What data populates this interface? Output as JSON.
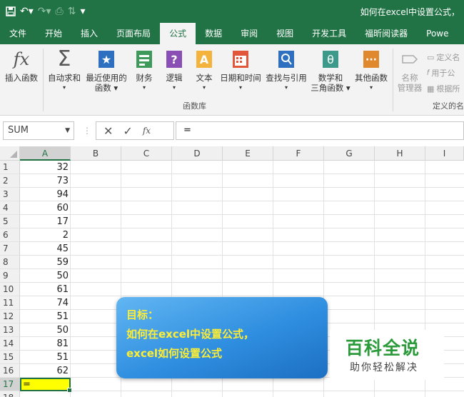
{
  "window": {
    "title": "如何在excel中设置公式，"
  },
  "tabs": [
    "文件",
    "开始",
    "插入",
    "页面布局",
    "公式",
    "数据",
    "审阅",
    "视图",
    "开发工具",
    "福昕阅读器",
    "Powe"
  ],
  "active_tab": "公式",
  "ribbon": {
    "insert_function": "插入函数",
    "autosum": "自动求和",
    "recent_line1": "最近使用的",
    "recent_line2": "函数",
    "financial": "财务",
    "logical": "逻辑",
    "text": "文本",
    "datetime": "日期和时间",
    "lookup": "查找与引用",
    "math_line1": "数学和",
    "math_line2": "三角函数",
    "other": "其他函数",
    "name_manager_line1": "名称",
    "name_manager_line2": "管理器",
    "define_name": "定义名",
    "use_in_formula": "用于公",
    "create_from_selection": "根据所",
    "library_group_label": "函数库",
    "names_group_label": "定义的名"
  },
  "formula_bar": {
    "name_box": "SUM",
    "formula": "="
  },
  "columns": [
    "A",
    "B",
    "C",
    "D",
    "E",
    "F",
    "G",
    "H",
    "I"
  ],
  "rows": [
    "1",
    "2",
    "3",
    "4",
    "5",
    "6",
    "7",
    "8",
    "9",
    "10",
    "11",
    "12",
    "13",
    "14",
    "15",
    "16",
    "17",
    "18"
  ],
  "column_a_values": [
    "32",
    "73",
    "94",
    "60",
    "17",
    "2",
    "45",
    "59",
    "50",
    "61",
    "74",
    "51",
    "50",
    "81",
    "51",
    "62"
  ],
  "active_cell": {
    "ref": "A17",
    "value": "="
  },
  "overlay": {
    "line1": "目标：",
    "line2": "如何在excel中设置公式，",
    "line3": "excel如何设置公式"
  },
  "brand": {
    "name": "百科全说",
    "tagline": "助你轻松解决"
  }
}
